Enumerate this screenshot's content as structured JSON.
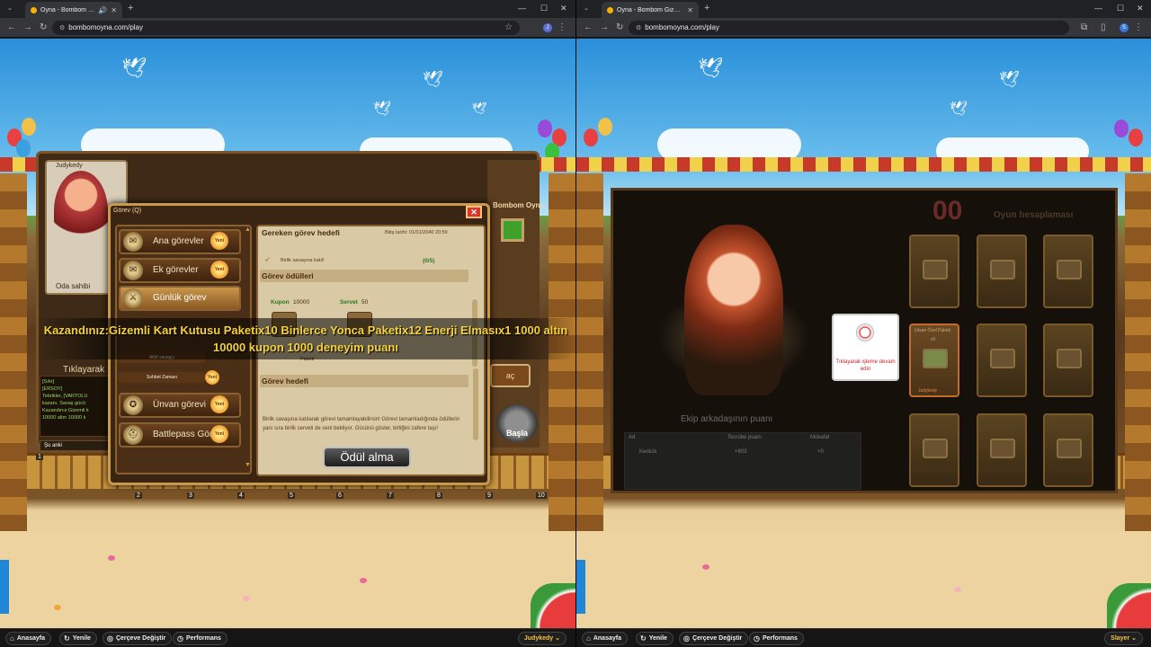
{
  "left": {
    "tab_title": "Oyna - Bombom Gizemler İ",
    "url": "bombomoyna.com/play",
    "game": {
      "player_name": "Judykedy",
      "room_owner_label": "Oda sahibi",
      "clickable_hint": "Tıklayarak",
      "chat_lines": [
        "[Sıfır]",
        "[ERSOY]",
        "Tebrikler, [VARTOLU",
        "kazanı. Savaş gücü",
        "Kazandınız:Gizemli k",
        "10000 altın 10000 k"
      ],
      "chat_input": "Şu anki",
      "right_panel_title": "Bombom Oyna",
      "ac_label": "aç",
      "start_label": "Başla",
      "fence_numbers": [
        "1",
        "2",
        "3",
        "4",
        "5",
        "6",
        "7",
        "8",
        "9",
        "10"
      ],
      "bottom_small_label": "Yükseme"
    },
    "dialog": {
      "title": "Görev (Q)",
      "menu": [
        {
          "label": "Ana görevler",
          "icon": "scroll-icon"
        },
        {
          "label": "Ek görevler",
          "icon": "scroll-icon"
        },
        {
          "label": "Günlük görev",
          "icon": "swords-icon"
        },
        {
          "label": "Ünvan görevi",
          "icon": "medal-icon"
        },
        {
          "label": "Battlepass Görevi",
          "icon": "helmet-icon"
        }
      ],
      "badge_text": "Yeni",
      "sub_items": [
        "Aktif savaşçı",
        "Sohbet Zamanı"
      ],
      "target_header": "Gereken görev hedefi",
      "deadline": "Bitiş tarihi: 01/01/2040 20:59",
      "task_item": "Birlik savaşına katıl!",
      "progress": "(0/5)",
      "rewards_header": "Görev ödülleri",
      "kupon_label": "Kupon",
      "kupon_value": "10000",
      "servet_label": "Servet",
      "servet_value": "50",
      "reward_item": "Paketi",
      "goal_header": "Görev hedefi",
      "goal_text": "Birlik savaşına katılarak görevi tamamlayabilirsin! Görevi tamamladığında ödüllerin yanı sıra birlik serveti de seni bekliyor. Gücünü göster, birliğini zafere taşı!",
      "claim_button": "Ödül alma"
    },
    "banner": "Kazandınız:Gizemli Kart Kutusu Paketix10 Binlerce Yonca Paketix12 Enerji Elmasıx1 1000 altın 10000 kupon 1000 deneyim puanı",
    "bottom": {
      "home": "Anasayfa",
      "refresh": "Yenile",
      "frame": "Çerçeve Değiştir",
      "perf": "Performans",
      "user": "Judykedy"
    }
  },
  "right": {
    "tab_title": "Oyna - Bombom Gizemler Diya",
    "url": "bombomoyna.com/play",
    "score": "00",
    "score_label": "Oyun hesaplaması",
    "card_open_title": "Utsan Özel Paketi",
    "card_open_count": "x5",
    "card_open_owner": "Judykedy",
    "popup_text": "Tıklayarak işleme devam edin",
    "team_title": "Ekip arkadaşının puanı",
    "table_headers": [
      "Ad",
      "Tecrübe puanı",
      "Mükafat"
    ],
    "table_row": [
      "Kedicik",
      "+803",
      "+0"
    ],
    "bottom": {
      "home": "Anasayfa",
      "refresh": "Yenile",
      "frame": "Çerçeve Değiştir",
      "perf": "Performans",
      "user": "Slayer"
    }
  }
}
